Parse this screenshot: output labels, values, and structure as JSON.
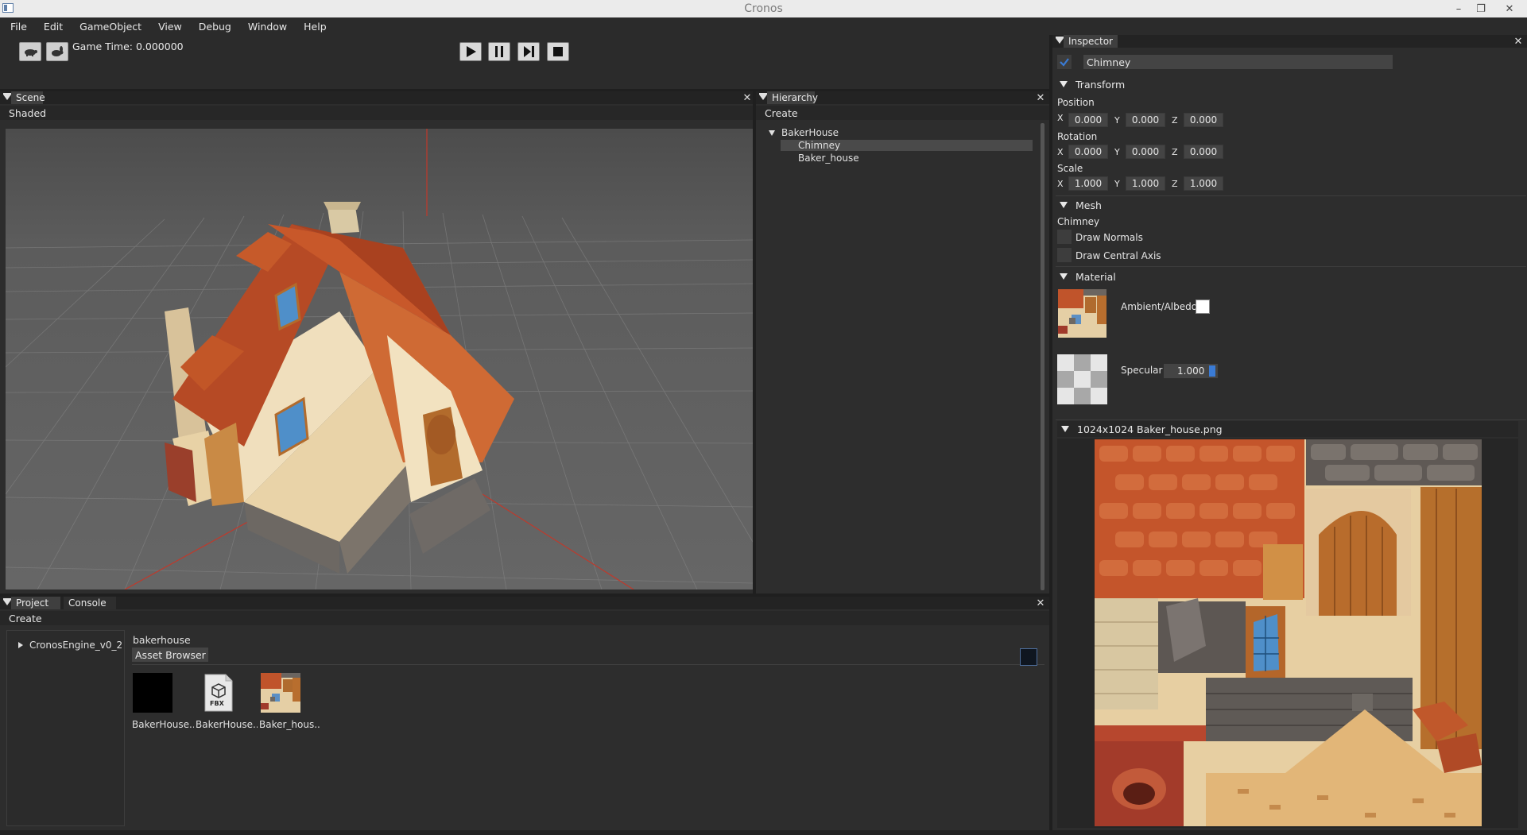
{
  "window": {
    "title": "Cronos",
    "minimize": "–",
    "restore": "❐",
    "close": "✕"
  },
  "menu": [
    "File",
    "Edit",
    "GameObject",
    "View",
    "Debug",
    "Window",
    "Help"
  ],
  "toolbar": {
    "game_time_label": "Game Time: 0.000000"
  },
  "scene": {
    "tab": "Scene",
    "shading_mode": "Shaded"
  },
  "hierarchy": {
    "tab": "Hierarchy",
    "create": "Create",
    "root": "BakerHouse",
    "children": [
      "Chimney",
      "Baker_house"
    ],
    "selected": "Chimney"
  },
  "inspector": {
    "tab": "Inspector",
    "object_name": "Chimney",
    "active": true,
    "transform": {
      "title": "Transform",
      "position_label": "Position",
      "rotation_label": "Rotation",
      "scale_label": "Scale",
      "position": [
        "0.000",
        "0.000",
        "0.000"
      ],
      "rotation": [
        "0.000",
        "0.000",
        "0.000"
      ],
      "scale": [
        "1.000",
        "1.000",
        "1.000"
      ],
      "axes": [
        "X",
        "Y",
        "Z"
      ]
    },
    "mesh": {
      "title": "Mesh",
      "mesh_name": "Chimney",
      "draw_normals": "Draw Normals",
      "draw_central_axis": "Draw Central Axis"
    },
    "material": {
      "title": "Material",
      "ambient_label": "Ambient/Albedo",
      "specular_label": "Specular",
      "specular_value": "1.000",
      "ambient_color": "#ffffff"
    },
    "texture_preview": {
      "title": "1024x1024 Baker_house.png"
    }
  },
  "project": {
    "tabs": [
      "Project",
      "Console"
    ],
    "create": "Create",
    "tree_root": "CronosEngine_v0_2",
    "folder": "bakerhouse",
    "asset_browser_label": "Asset Browser",
    "assets": [
      {
        "name": "BakerHouse...",
        "icon": "black-material-icon"
      },
      {
        "name": "BakerHouse...",
        "icon": "fbx-file-icon",
        "badge": "FBX"
      },
      {
        "name": "Baker_hous...",
        "icon": "texture-thumbnail-icon"
      }
    ]
  },
  "colors": {
    "accent": "#3a7bd5",
    "panel_bg": "#2d2d2d",
    "selection": "#4a4a4a"
  }
}
